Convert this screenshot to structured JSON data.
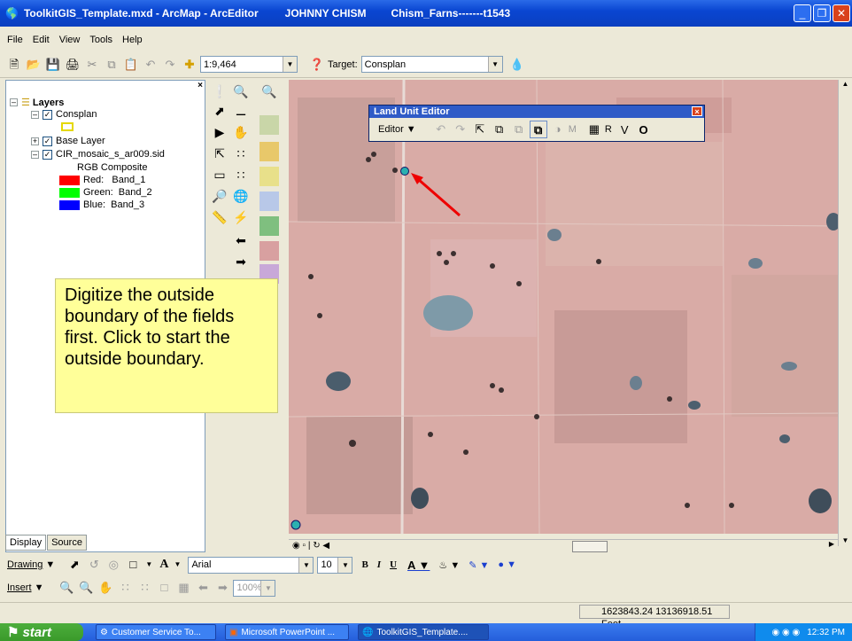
{
  "window": {
    "title": "ToolkitGIS_Template.mxd - ArcMap - ArcEditor",
    "user": "JOHNNY CHISM",
    "file": "Chism_Farns-------t1543"
  },
  "menu": [
    "File",
    "Edit",
    "View",
    "Tools",
    "Help"
  ],
  "standard_toolbar": {
    "scale": "1:9,464",
    "target_label": "Target:",
    "target_value": "Consplan"
  },
  "toc": {
    "root": "Layers",
    "layers": [
      {
        "name": "Consplan"
      },
      {
        "name": "Base Layer"
      },
      {
        "name": "CIR_mosaic_s_ar009.sid"
      }
    ],
    "rgb_label": "RGB Composite",
    "bands": [
      {
        "label": "Red:   Band_1",
        "color": "#ff0000"
      },
      {
        "label": "Green:  Band_2",
        "color": "#00ff00"
      },
      {
        "label": "Blue:  Band_3",
        "color": "#0000ff"
      }
    ],
    "consplan_symbol_color": "#ffff00",
    "tabs": [
      "Display",
      "Source"
    ]
  },
  "callout": {
    "text": "Digitize the outside boundary of the fields first. Click to start the outside boundary."
  },
  "land_unit_editor": {
    "title": "Land Unit Editor",
    "editor_menu": "Editor",
    "letters": [
      "M",
      "R",
      "V",
      "O"
    ]
  },
  "drawing_toolbar": {
    "drawing_label": "Drawing",
    "font": "Arial",
    "font_size": "10",
    "bold": "B",
    "italic": "I",
    "underline": "U"
  },
  "insert_toolbar": {
    "insert_label": "Insert",
    "zoom": "100%"
  },
  "status": {
    "coords": "1623843.24  13136918.51 Feet"
  },
  "taskbar": {
    "start": "start",
    "tasks": [
      "Customer Service To...",
      "Microsoft PowerPoint ...",
      "ToolkitGIS_Template...."
    ],
    "clock": "12:32 PM"
  }
}
